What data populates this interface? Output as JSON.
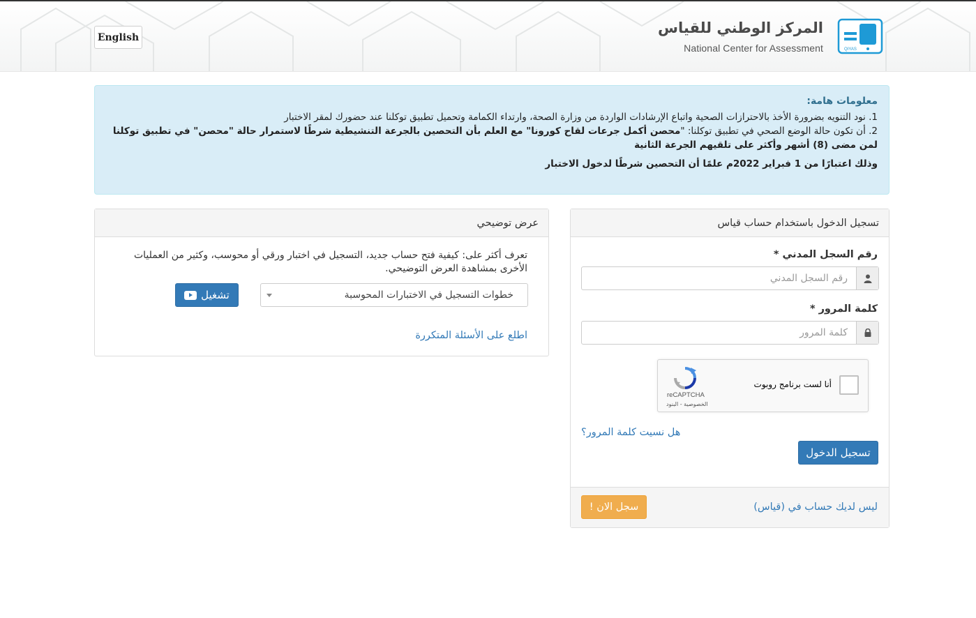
{
  "header": {
    "language_button": "English",
    "logo_arabic": "المركز الوطني للقياس",
    "logo_english": "National Center for Assessment",
    "logo_badge_text": "QIYAS"
  },
  "notice": {
    "title": "معلومات هامة:",
    "item1": "1. نود التنويه بضرورة الأخذ بالاحترازات الصحية واتباع الإرشادات الواردة من وزارة الصحة، وارتداء الكمامة وتحميل تطبيق توكلنا عند حضورك لمقر الاختبار",
    "item2_prefix": "2. أن تكون حالة الوضع الصحي في تطبيق توكلنا: \"",
    "item2_bold": "محصن أكمل جرعات لقاح كورونا\" مع العلم بأن التحصين بالجرعة التنشيطية شرطًا لاستمرار حالة \"محصن\" في تطبيق توكلنا لمن مضى (8) أشهر وأكثر على تلقيهم الجرعة الثانية",
    "closing": "وذلك اعتبارًا من 1 فبراير 2022م علمًا أن التحصين شرطًا لدخول الاختبار"
  },
  "demo": {
    "heading": "عرض توضيحي",
    "description": "تعرف أكثر على: كيفية فتح حساب جديد، التسجيل في اختبار ورقي أو محوسب، وكثير من العمليات الأخرى بمشاهدة العرض التوضيحي.",
    "selected_option": "خطوات التسجيل في الاختبارات المحوسبة",
    "play_button": "تشغيل",
    "faq_link": "اطلع على الأسئلة المتكررة"
  },
  "login": {
    "heading": "تسجيل الدخول باستخدام حساب قياس",
    "id_label": "رقم السجل المدني *",
    "id_placeholder": "رقم السجل المدني",
    "password_label": "كلمة المرور *",
    "password_placeholder": "كلمة المرور",
    "captcha_label": "أنا لست برنامج روبوت",
    "captcha_brand": "reCAPTCHA",
    "captcha_links": "الخصوصية - البنود",
    "forgot_link": "هل نسيت كلمة المرور؟",
    "submit_button": "تسجيل الدخول",
    "no_account_text": "ليس لديك حساب في (قياس)",
    "register_button": "سجل الان !"
  },
  "colors": {
    "primary": "#337ab7",
    "warning": "#f0ad4e",
    "info_bg": "#d9edf7",
    "info_title": "#31708f"
  },
  "icons": {
    "user_addon": "user-icon",
    "password_addon": "lock-icon",
    "play": "youtube-play-icon",
    "captcha": "recaptcha-icon"
  }
}
